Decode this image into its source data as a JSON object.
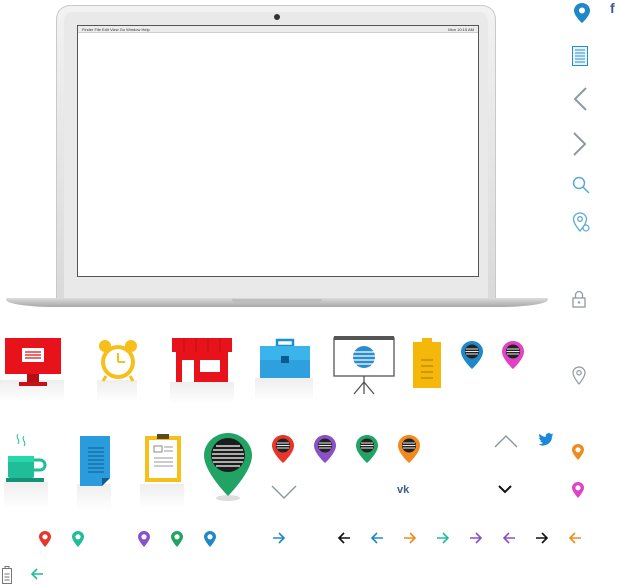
{
  "laptop": {
    "menubar_left": "  Finder  File  Edit  View  Go  Window  Help",
    "menubar_right": "Mon 10:15 AM"
  },
  "social": {
    "facebook_glyph": "f",
    "vk_glyph": "vk"
  },
  "colors": {
    "red": "#e8352a",
    "red_bright": "#e8131a",
    "yellow": "#f7bf19",
    "blue": "#1e88c8",
    "teal": "#1fbd98",
    "green": "#21a363",
    "purple": "#8a50c8",
    "orange": "#f08a1c",
    "magenta": "#e141c6",
    "gray_icon": "#8e9aa3",
    "sky": "#35b6e8"
  },
  "icons": [
    "monitor-icon",
    "alarm-clock-icon",
    "store-icon",
    "briefcase-icon",
    "presentation-board-icon",
    "battery-icon",
    "map-pin-icon",
    "coffee-cup-icon",
    "document-icon",
    "clipboard-icon",
    "arrow-left-icon",
    "arrow-right-icon",
    "chevron-up-icon",
    "chevron-down-icon",
    "search-icon",
    "lock-icon",
    "twitter-icon",
    "facebook-icon",
    "vk-icon"
  ]
}
